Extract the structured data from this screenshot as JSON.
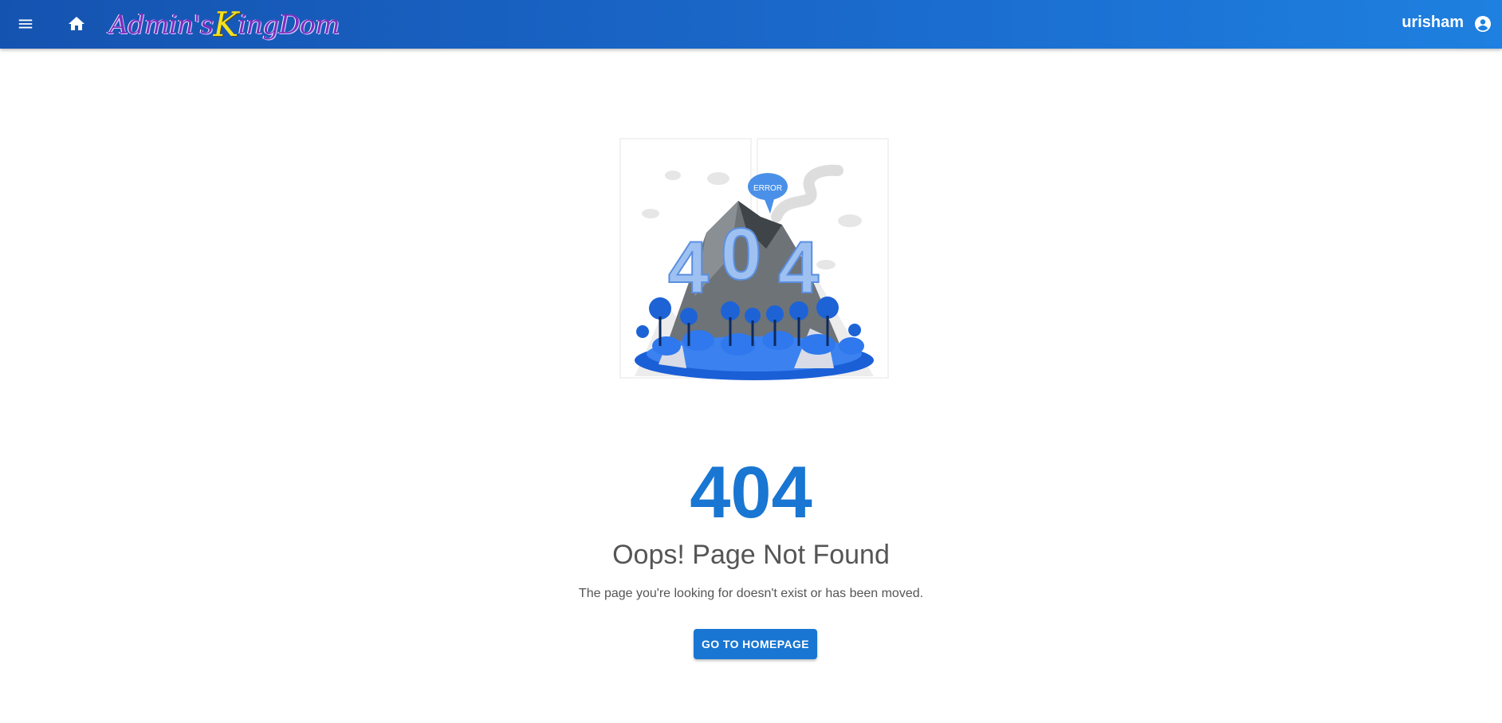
{
  "appbar": {
    "logo_part1": "Admin's ",
    "logo_k": "K",
    "logo_part2": "ingDom",
    "username": "urisham",
    "icons": [
      "menu-icon",
      "home-icon",
      "account-circle-icon"
    ]
  },
  "illustration": {
    "bubble_text": "ERROR",
    "mountain_text": "404"
  },
  "error": {
    "code": "404",
    "title": "Oops! Page Not Found",
    "description": "The page you're looking for doesn't exist or has been moved.",
    "button_label": "GO TO HOMEPAGE"
  },
  "colors": {
    "appbar_start": "#1553b0",
    "appbar_end": "#1e80e0",
    "accent": "#1976d2",
    "text_secondary": "#555555"
  }
}
